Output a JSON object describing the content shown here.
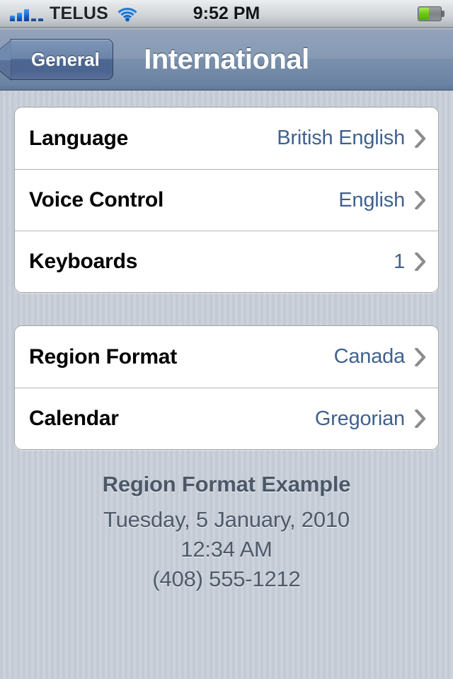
{
  "status_bar": {
    "carrier": "TELUS",
    "time": "9:52 PM",
    "signal_icon": "signal-bars-icon",
    "signal_bars_filled": 3,
    "signal_bars_total": 5,
    "wifi_icon": "wifi-icon",
    "battery_icon": "battery-icon",
    "battery_percent": 47,
    "battery_color": "#6fcc16"
  },
  "nav_bar": {
    "back_label": "General",
    "back_icon": "back-chevron-icon",
    "title": "International"
  },
  "groups": [
    {
      "rows": [
        {
          "label": "Language",
          "value": "British English",
          "accessory": "disclosure-chevron-icon"
        },
        {
          "label": "Voice Control",
          "value": "English",
          "accessory": "disclosure-chevron-icon"
        },
        {
          "label": "Keyboards",
          "value": "1",
          "accessory": "disclosure-chevron-icon"
        }
      ]
    },
    {
      "rows": [
        {
          "label": "Region Format",
          "value": "Canada",
          "accessory": "disclosure-chevron-icon"
        },
        {
          "label": "Calendar",
          "value": "Gregorian",
          "accessory": "disclosure-chevron-icon"
        }
      ]
    }
  ],
  "footer": {
    "title": "Region Format Example",
    "lines": [
      "Tuesday, 5 January, 2010",
      "12:34 AM",
      "(408) 555-1212"
    ]
  },
  "colors": {
    "value_text": "#41618f",
    "label_text": "#000000",
    "footer_text": "#4e5a69",
    "nav_bar": "#7991ad",
    "wallpaper": "#c5ccd6"
  }
}
